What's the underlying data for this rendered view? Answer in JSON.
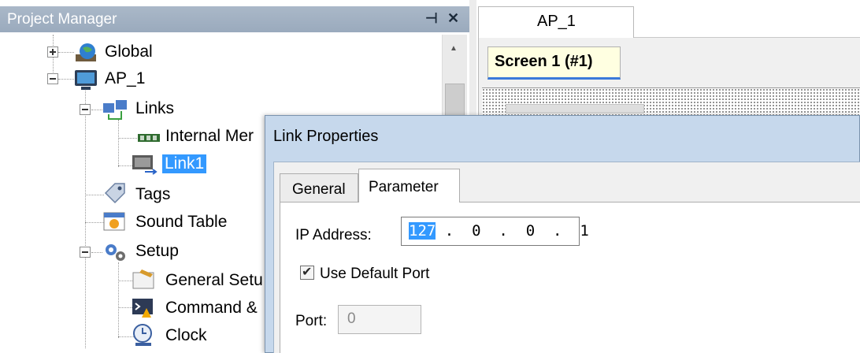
{
  "project_manager": {
    "title": "Project Manager",
    "pin_glyph": "⊣",
    "close_glyph": "✕",
    "tree": [
      {
        "label": "Global",
        "icon": "globe-icon",
        "expander": "plus"
      },
      {
        "label": "AP_1",
        "icon": "monitor-icon",
        "expander": "minus"
      },
      {
        "label": "Links",
        "icon": "links-icon",
        "expander": "minus"
      },
      {
        "label": "Internal Mer",
        "icon": "memory-chip-icon"
      },
      {
        "label": "Link1",
        "icon": "link-device-icon",
        "selected": true
      },
      {
        "label": "Tags",
        "icon": "tags-icon"
      },
      {
        "label": "Sound Table",
        "icon": "sound-table-icon"
      },
      {
        "label": "Setup",
        "icon": "setup-gears-icon",
        "expander": "minus"
      },
      {
        "label": "General Setu",
        "icon": "general-setup-icon"
      },
      {
        "label": "Command &",
        "icon": "command-icon"
      },
      {
        "label": "Clock",
        "icon": "clock-icon"
      }
    ]
  },
  "editor": {
    "document_tab": "AP_1",
    "screen_tab": "Screen 1 (#1)"
  },
  "dialog": {
    "title": "Link Properties",
    "tabs": [
      "General",
      "Parameter"
    ],
    "active_tab": "Parameter",
    "ip_label": "IP Address:",
    "ip_octets": [
      "127",
      "0",
      "0",
      "1"
    ],
    "ip_rest": " .  0  .  0  .  1",
    "use_default_port_label": "Use Default Port",
    "use_default_port_checked": true,
    "port_label": "Port:",
    "port_value": "0"
  },
  "colors": {
    "selection": "#3399ff",
    "panel_title": "#9aaabd",
    "dialog_frame": "#c6d8ec",
    "screen_tab_bg": "#ffffe1"
  }
}
